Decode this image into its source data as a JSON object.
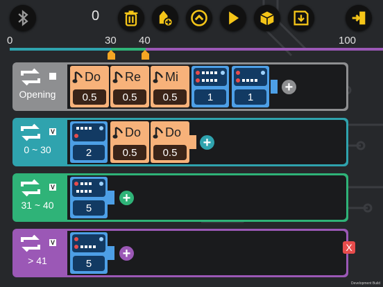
{
  "toolbar": {
    "counter": "0",
    "buttons": [
      {
        "name": "bluetooth-button",
        "icon": "bluetooth-icon"
      },
      {
        "name": "delete-button",
        "icon": "trash-icon"
      },
      {
        "name": "add-button",
        "icon": "add-icon"
      },
      {
        "name": "up-button",
        "icon": "chevron-up-icon"
      },
      {
        "name": "play-button",
        "icon": "play-icon"
      },
      {
        "name": "open-button",
        "icon": "box-icon"
      },
      {
        "name": "save-button",
        "icon": "save-icon"
      },
      {
        "name": "exit-button",
        "icon": "exit-icon"
      }
    ]
  },
  "timeline": {
    "labels": {
      "start": "0",
      "m1": "30",
      "m2": "40",
      "end": "100"
    }
  },
  "rows": [
    {
      "label": "Opening",
      "flag": "",
      "notes": [
        {
          "type": "note",
          "name": "Do",
          "value": "0.5"
        },
        {
          "type": "note",
          "name": "Re",
          "value": "0.5"
        },
        {
          "type": "note",
          "name": "Mi",
          "value": "0.5"
        },
        {
          "type": "beat",
          "value": "1"
        },
        {
          "type": "beat",
          "value": "1"
        }
      ]
    },
    {
      "label": "0 ~ 30",
      "flag": "V",
      "notes": [
        {
          "type": "beat",
          "value": "2"
        },
        {
          "type": "note",
          "name": "Do",
          "value": "0.5"
        },
        {
          "type": "note",
          "name": "Do",
          "value": "0.5"
        }
      ]
    },
    {
      "label": "31 ~ 40",
      "flag": "V",
      "notes": [
        {
          "type": "beat",
          "value": "5"
        }
      ]
    },
    {
      "label": "> 41",
      "flag": "V",
      "notes": [
        {
          "type": "beat",
          "value": "5"
        }
      ]
    }
  ],
  "delete_row_label": "X",
  "footer": "Development Build",
  "colors": {
    "row0": "#8e8f91",
    "row1": "#2fa3ae",
    "row2": "#2fb378",
    "row3": "#9b58b6",
    "note": "#f7b27a",
    "beat": "#4d9fe6",
    "accent": "#f5c518"
  }
}
